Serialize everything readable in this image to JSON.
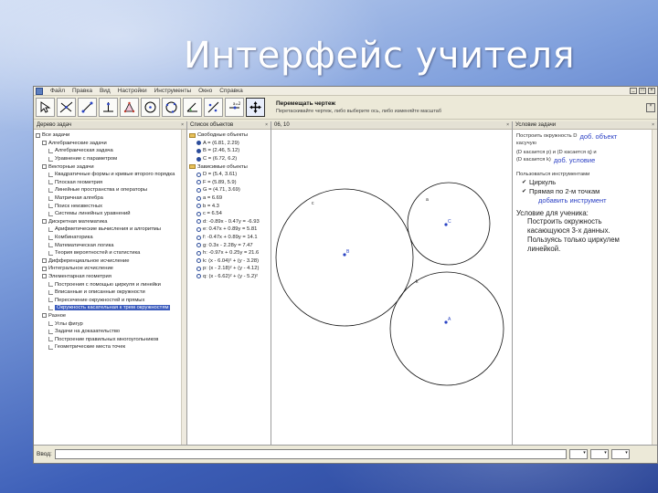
{
  "slide": {
    "title": "Интерфейс учителя"
  },
  "menu": [
    "Файл",
    "Правка",
    "Вид",
    "Настройки",
    "Инструменты",
    "Окно",
    "Справка"
  ],
  "toolbar": {
    "tools": [
      "move-icon",
      "line-icon",
      "segment-icon",
      "perpendicular-icon",
      "polygon-icon",
      "circle-icon",
      "circle3-icon",
      "angle-icon",
      "reflect-icon",
      "slider-icon",
      "move-view-icon"
    ],
    "active_index": 10,
    "info_title": "Перемещать чертеж",
    "info_hint": "Перетаскивайте чертеж, либо выберите ось, либо изменяйте масштаб"
  },
  "tree_pane": {
    "header": "Дерево задач",
    "rows": [
      {
        "t": "Все задачи",
        "indent": 0
      },
      {
        "t": "Алгебраические задачи",
        "indent": 1
      },
      {
        "t": "Алгебраическая задача",
        "indent": 2
      },
      {
        "t": "Уравнение с параметром",
        "indent": 2
      },
      {
        "t": "Векторные задачи",
        "indent": 1
      },
      {
        "t": "Квадратичные формы и кривые второго порядка",
        "indent": 2
      },
      {
        "t": "Плоская геометрия",
        "indent": 2
      },
      {
        "t": "Линейные пространства и операторы",
        "indent": 2
      },
      {
        "t": "Матричная алгебра",
        "indent": 2
      },
      {
        "t": "Поиск неизвестных",
        "indent": 2
      },
      {
        "t": "Системы линейных уравнений",
        "indent": 2
      },
      {
        "t": "Дискретная математика",
        "indent": 1
      },
      {
        "t": "Арифметические вычисления и алгоритмы",
        "indent": 2
      },
      {
        "t": "Комбинаторика",
        "indent": 2
      },
      {
        "t": "Математическая логика",
        "indent": 2
      },
      {
        "t": "Теория вероятностей и статистика",
        "indent": 2
      },
      {
        "t": "Дифференциальное исчисление",
        "indent": 1
      },
      {
        "t": "Интегральное исчисление",
        "indent": 1
      },
      {
        "t": "Элементарная геометрия",
        "indent": 1
      },
      {
        "t": "Построения с помощью циркуля и линейки",
        "indent": 2
      },
      {
        "t": "Вписанные и описанные окружности",
        "indent": 2
      },
      {
        "t": "Пересечение окружностей и прямых",
        "indent": 2
      },
      {
        "t": "Окружность касательная к трем окружностям",
        "indent": 2,
        "selected": true
      },
      {
        "t": "Разное",
        "indent": 1
      },
      {
        "t": "Углы фигур",
        "indent": 2
      },
      {
        "t": "Задачи на доказательство",
        "indent": 2
      },
      {
        "t": "Построение правильных многоугольников",
        "indent": 2
      },
      {
        "t": "Геометрические места точек",
        "indent": 2
      }
    ]
  },
  "objects_pane": {
    "header": "Список объектов",
    "rows": [
      {
        "t": "Свободные объекты",
        "kind": "folder"
      },
      {
        "t": "A = (6.81, 2.29)",
        "kind": "dot"
      },
      {
        "t": "B = (2.46, 5.12)",
        "kind": "dot"
      },
      {
        "t": "C = (6.72, 6.2)",
        "kind": "dot"
      },
      {
        "t": "Зависимые объекты",
        "kind": "folder"
      },
      {
        "t": "D = (5.4, 3.61)",
        "kind": "ring"
      },
      {
        "t": "F = (5.89, 5.9)",
        "kind": "ring"
      },
      {
        "t": "G = (4.71, 3.69)",
        "kind": "ring"
      },
      {
        "t": "a = 6.69",
        "kind": "ring"
      },
      {
        "t": "b = 4.3",
        "kind": "ring"
      },
      {
        "t": "c = 6.54",
        "kind": "ring"
      },
      {
        "t": "d: -0.89x - 0.47y = -6.93",
        "kind": "ring"
      },
      {
        "t": "e: 0.47x + 0.89y = 5.81",
        "kind": "ring"
      },
      {
        "t": "f: -0.47x + 0.89y = 14.1",
        "kind": "ring"
      },
      {
        "t": "g: 0.3x - 2.28y = 7.47",
        "kind": "ring"
      },
      {
        "t": "h: -0.97x + 0.25y = 21.6",
        "kind": "ring"
      },
      {
        "t": "k: (x - 6.04)² + (y - 3.28)",
        "kind": "ring"
      },
      {
        "t": "p: (x - 2.18)² + (y - 4.12)",
        "kind": "ring"
      },
      {
        "t": "q: (x - 6.62)² + (y - 5.2)²",
        "kind": "ring"
      }
    ]
  },
  "canvas": {
    "header": "06, 10",
    "labels": {
      "A": "A",
      "B": "B",
      "C": "C",
      "c": "c",
      "a": "a",
      "k": "k"
    }
  },
  "task_pane": {
    "header": "Условие задачи",
    "line1": "Построить окружность D",
    "link_add_object": "доб. объект",
    "line2": "касучую",
    "line3": "(D касается p) и (D касается q) и",
    "line4": "(D касается k)",
    "link_add_condition": "доб. условие",
    "tools_caption": "Пользоваться инструментами",
    "tool1": "Циркуль",
    "tool2": "Прямая по 2-м точкам",
    "link_add_tool": "добавить инструмент",
    "student_title": "Условие для ученика:",
    "student_text": [
      "Построить окружность",
      "касающуюся 3-х данных.",
      "Пользуясь только циркулем",
      "линейкой."
    ]
  },
  "statusbar": {
    "label": "Ввод:"
  }
}
